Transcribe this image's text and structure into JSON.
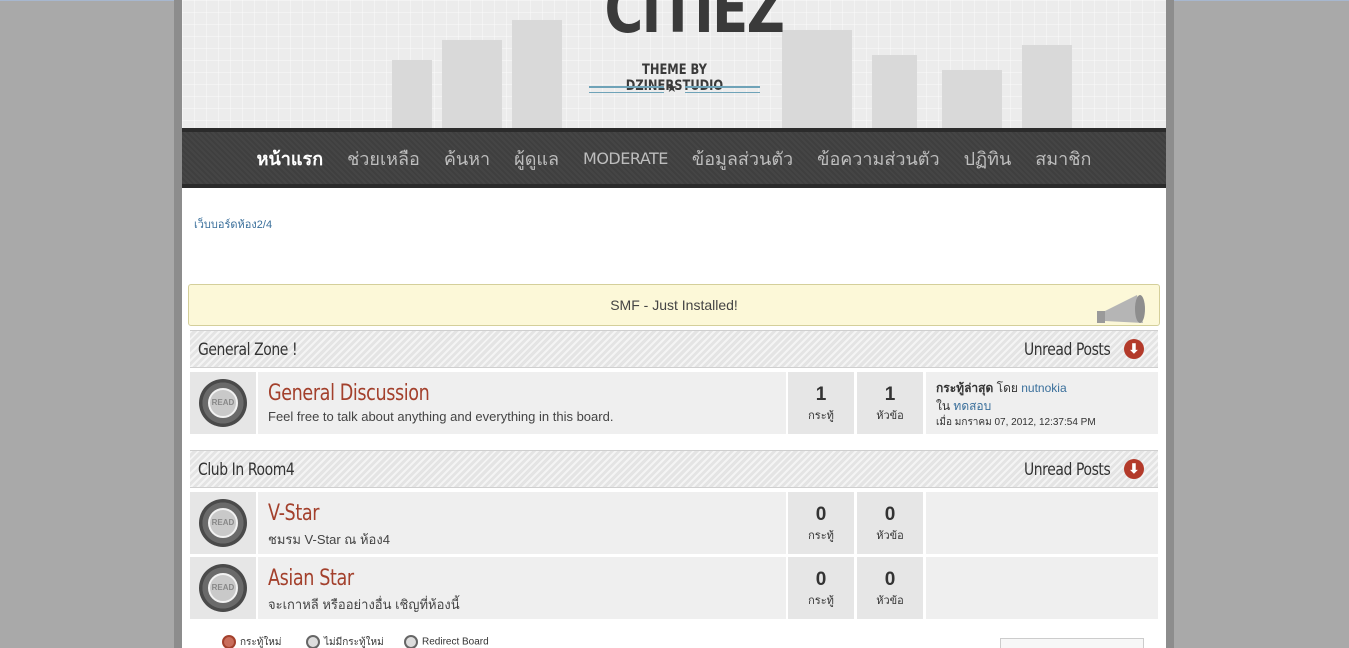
{
  "header": {
    "logo_big": "CITIEZ",
    "logo_sub": "THEME BY DZINERSTUDIO",
    "logo_star": "★"
  },
  "nav": {
    "items": [
      {
        "label": "หน้าแรก"
      },
      {
        "label": "ช่วยเหลือ"
      },
      {
        "label": "ค้นหา"
      },
      {
        "label": "ผู้ดูแล"
      },
      {
        "label": "MODERATE"
      },
      {
        "label": "ข้อมูลส่วนตัว"
      },
      {
        "label": "ข้อความส่วนตัว"
      },
      {
        "label": "ปฏิทิน"
      },
      {
        "label": "สมาชิก"
      }
    ]
  },
  "breadcrumb": "เว็บบอร์ดห้อง2/4",
  "news": "SMF - Just Installed!",
  "categories": [
    {
      "title": "General Zone !",
      "unread": "Unread Posts",
      "boards": [
        {
          "name": "General Discussion",
          "desc": "Feel free to talk about anything and everything in this board.",
          "posts": "1",
          "posts_label": "กระทู้",
          "topics": "1",
          "topics_label": "หัวข้อ",
          "last_post_label": "กระทู้ล่าสุด",
          "by": "โดย",
          "last_user": "nutnokia",
          "in": "ใน",
          "last_topic": "ทดสอบ",
          "last_time": "เมื่อ มกราคม 07, 2012, 12:37:54 PM"
        }
      ]
    },
    {
      "title": "Club In Room4",
      "unread": "Unread Posts",
      "boards": [
        {
          "name": "V-Star",
          "desc": "ชมรม V-Star ณ ห้อง4",
          "posts": "0",
          "posts_label": "กระทู้",
          "topics": "0",
          "topics_label": "หัวข้อ"
        },
        {
          "name": "Asian Star",
          "desc": "จะเกาหลี หรืออย่างอื่น เชิญที่ห้องนี้",
          "posts": "0",
          "posts_label": "กระทู้",
          "topics": "0",
          "topics_label": "หัวข้อ"
        }
      ]
    }
  ],
  "board_icon_text": "READ",
  "collapse_icon": "⬇",
  "legend": [
    {
      "label": "กระทู้ใหม่"
    },
    {
      "label": "ไม่มีกระทู้ใหม่"
    },
    {
      "label": "Redirect Board"
    }
  ]
}
